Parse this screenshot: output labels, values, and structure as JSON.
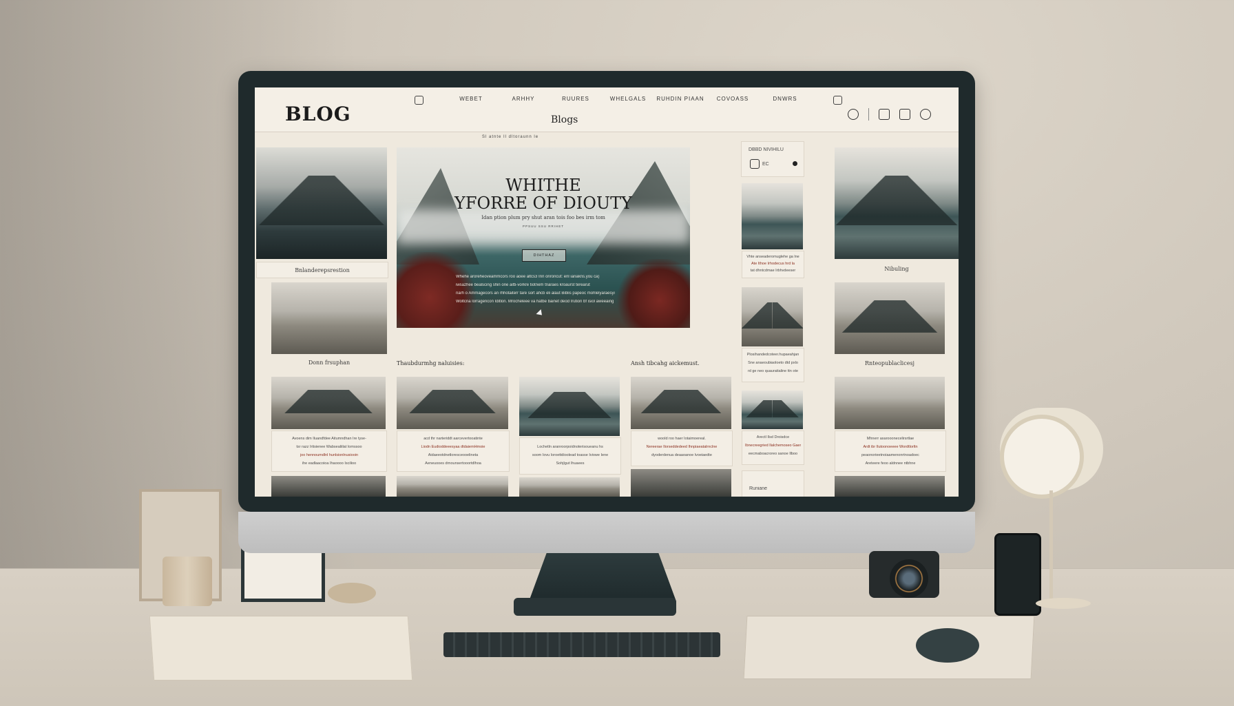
{
  "header": {
    "logo": "BLOG",
    "nav": [
      "WEBET",
      "ARHHY",
      "RUURES",
      "WHELGALS",
      "RUHDIN PIAAN",
      "COVOASS",
      "DNWRS"
    ],
    "subtitle": "Blogs",
    "breadcrumb": "Sl   atnte   Il   dltoraunn   le"
  },
  "hero": {
    "title_line1": "WHITHE",
    "title_line2": "YFORRE OF DIOUTY",
    "subtitle": "Idan ption plum pry shut aran tois foo bes irm tom",
    "small": "PPSUU  SSU  RRIHET",
    "button": "DIHTHAZ",
    "text": [
      "Whehe aroreheoveammcors roo aoee altcs3 Inn onroncut: enl ianakns.you ca)",
      "iwsazhee bealscing shin one aitti-vorkre tiotnem tnaraes kroaurst terearut",
      "narh o Ammagecors an rhhotaiterr tare sort ahcb eli alaut Biblis papeoc mohlelyaraesyi",
      "Woltcna lorragencon Iditlon. Mrocheleee va hatbe bainet deod Irution bf isiol aweeaing"
    ]
  },
  "left_column": {
    "caption_1": "Bnlanderepsrestion",
    "caption_2": "Donn frsuphan"
  },
  "sections": {
    "left": "Thaubdurmhg naluisies:",
    "right": "Ansh tibcahg aickemust."
  },
  "sidebar": {
    "box_title": "DBBD NIVIHILU",
    "box_value": "EC",
    "card1_text": [
      "Vhte anseaderomuglehe ga lne",
      "Ate  Ithoe  Irhodecus  hrd  la",
      "tat  dhntcdmae  Irbhvdeeser"
    ],
    "card2_text": [
      "Plosihandedcoteer.hupaeahjan",
      "Sne anaeoubiaoloeto dtd pxlo",
      "rd ge neo quauratialine ttn ote"
    ],
    "card3_text": [
      "Arectl   Ilsd   Droisdce",
      "Ibnecreegried Ilalchemoseo Gaene",
      "eecmaboacroreo sanoe Ilboo"
    ],
    "footer": "Runiane"
  },
  "right_column": {
    "caption_1": "Nibuling",
    "caption_2": "Rnteopublaclicesj"
  },
  "grid_cards": [
    {
      "lines": [
        "Avoens dim Iluandfdee Aitumndhan Ire tyse-",
        "tsr razz Irtisienee Wabsealiilat Iomssoo",
        "joo hennoumdlnl hunlsionlnusiooin",
        "ihe eadlaacoioa Ihaoooo Iscilioo"
      ]
    },
    {
      "lines": [
        "acd thr narteriddt aarcevertooatinte",
        "Liodn Eudioddeeesyaa dtdaiemHmoie",
        "Aidaeeotdnetloresceooelineta",
        "Aeneuooes drnounsertooortdlhoa"
      ]
    },
    {
      "lines": [
        "Lochetln aranroorpoidnoterisoueanu hs",
        "soom Iovu Ioroettdioolead toasse Iviowe Iene",
        "Sohjlgut Ihuaees"
      ]
    },
    {
      "lines": [
        "woold  roo  haer  Iotaimoereal.",
        "Nereerae Ilorseddedeed Ihnpiaeatalrnclne",
        "dyoderdenua deaaoanoe lvoeiaedte"
      ]
    },
    {
      "lines": [
        "Mhnerr axarooonecelirsrtlae",
        "Ardt ibr Ilutoonoeeee Wordtlorltn",
        "peaonorieetnoiaamenonrtnoadoec",
        "Areteere  feoo  aldnnee  ntbhne"
      ]
    }
  ],
  "colors": {
    "screen_bg": "#efe9de",
    "bezel": "#1f2a2c",
    "accent_red": "#8a2e1e"
  }
}
